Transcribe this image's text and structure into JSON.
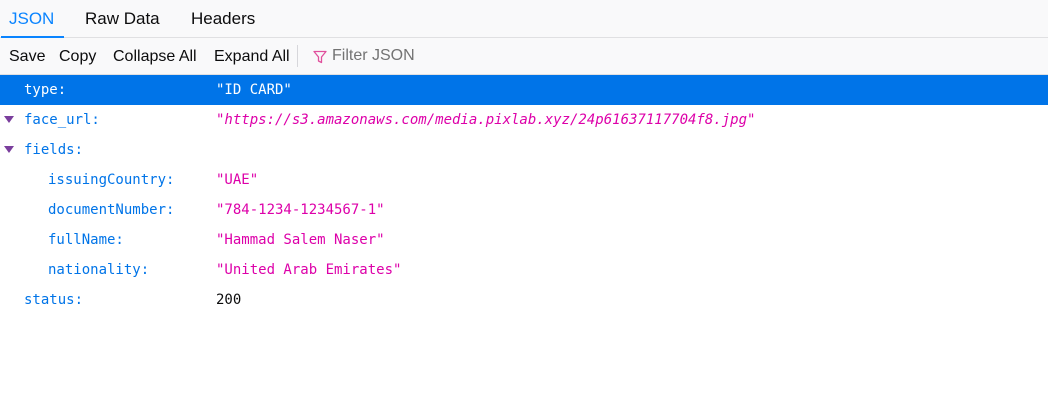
{
  "tabs": [
    {
      "label": "JSON",
      "selected": true
    },
    {
      "label": "Raw Data",
      "selected": false
    },
    {
      "label": "Headers",
      "selected": false
    }
  ],
  "toolbar": {
    "save": "Save",
    "copy": "Copy",
    "collapse_all": "Collapse All",
    "expand_all": "Expand All",
    "filter_placeholder": "Filter JSON",
    "filter_icon": "funnel-icon"
  },
  "tree": {
    "type": {
      "key": "type:",
      "value": "\"ID CARD\""
    },
    "face_url": {
      "key": "face_url:",
      "value": "\"https://s3.amazonaws.com/media.pixlab.xyz/24p61637117704f8.jpg\""
    },
    "fields": {
      "key": "fields:",
      "issuingCountry": {
        "key": "issuingCountry:",
        "value": "\"UAE\""
      },
      "documentNumber": {
        "key": "documentNumber:",
        "value": "\"784-1234-1234567-1\""
      },
      "fullName": {
        "key": "fullName:",
        "value": "\"Hammad Salem Naser\""
      },
      "nationality": {
        "key": "nationality:",
        "value": "\"United Arab Emirates\""
      }
    },
    "status": {
      "key": "status:",
      "value": "200"
    }
  },
  "colors": {
    "accent": "#0a84ff",
    "selected_row": "#0074e8",
    "key": "#0074e8",
    "string": "#dd00a9",
    "twisty": "#7a3e9d"
  }
}
